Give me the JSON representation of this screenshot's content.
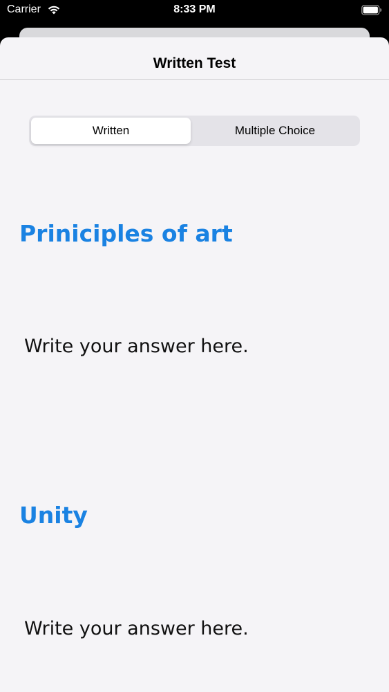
{
  "status_bar": {
    "carrier": "Carrier",
    "time": "8:33 PM",
    "icons": [
      "wifi-icon",
      "battery-icon"
    ]
  },
  "nav": {
    "title": "Written Test"
  },
  "segmented_control": {
    "segments": [
      {
        "label": "Written",
        "selected": true
      },
      {
        "label": "Multiple Choice",
        "selected": false
      }
    ]
  },
  "questions": [
    {
      "title": "Priniciples of art",
      "answer_placeholder": "Write your answer here."
    },
    {
      "title": "Unity",
      "answer_placeholder": "Write your answer here."
    }
  ],
  "colors": {
    "accent": "#1a82e2",
    "sheet_background": "#f5f4f7",
    "segmented_background": "#e4e3e8"
  }
}
